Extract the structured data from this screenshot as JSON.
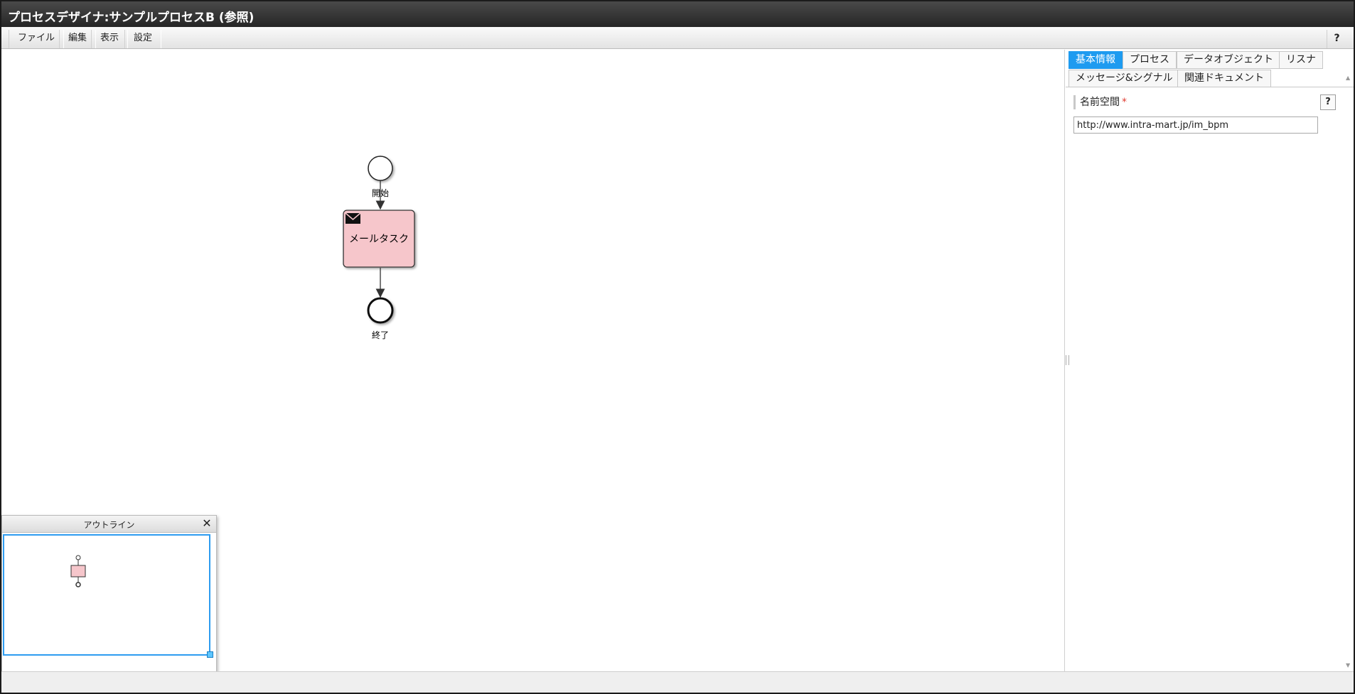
{
  "window": {
    "title": "プロセスデザイナ:サンプルプロセスB (参照)"
  },
  "menu": {
    "items": [
      {
        "label": "ファイル"
      },
      {
        "label": "編集"
      },
      {
        "label": "表示"
      },
      {
        "label": "設定"
      }
    ],
    "help_label": "?"
  },
  "diagram": {
    "start_label": "開始",
    "task_label": "メールタスク",
    "task_icon": "envelope-icon",
    "end_label": "終了",
    "task_fill": "#f6c6cb"
  },
  "outline": {
    "title": "アウトライン",
    "close_label": "✕"
  },
  "panel": {
    "tabs": [
      {
        "label": "基本情報",
        "active": true
      },
      {
        "label": "プロセス"
      },
      {
        "label": "データオブジェクト"
      },
      {
        "label": "リスナ"
      },
      {
        "label": "メッセージ&シグナル"
      },
      {
        "label": "関連ドキュメント"
      }
    ],
    "namespace": {
      "label": "名前空間",
      "required_mark": "*",
      "help_label": "?",
      "value": "http://www.intra-mart.jp/im_bpm"
    }
  },
  "colors": {
    "accent": "#1e9bf0",
    "titlebar": "#2e2e2e"
  }
}
